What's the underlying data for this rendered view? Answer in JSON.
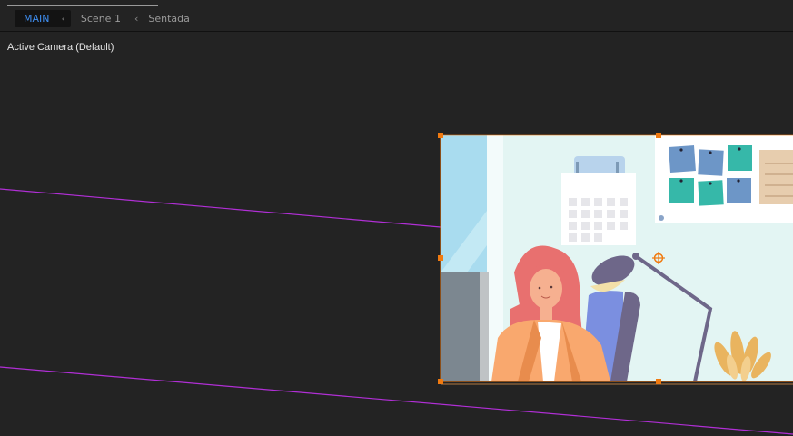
{
  "breadcrumb": {
    "items": [
      "MAIN",
      "Scene 1",
      "Sentada"
    ],
    "active_color": "#3f8ef0"
  },
  "viewer": {
    "camera_label": "Active Camera (Default)",
    "selection_color": "#f07a10",
    "motion_path_color": "#b12fd6"
  },
  "icons": {
    "chevron": "chevron-left-icon",
    "anchor": "anchor-point-icon"
  }
}
